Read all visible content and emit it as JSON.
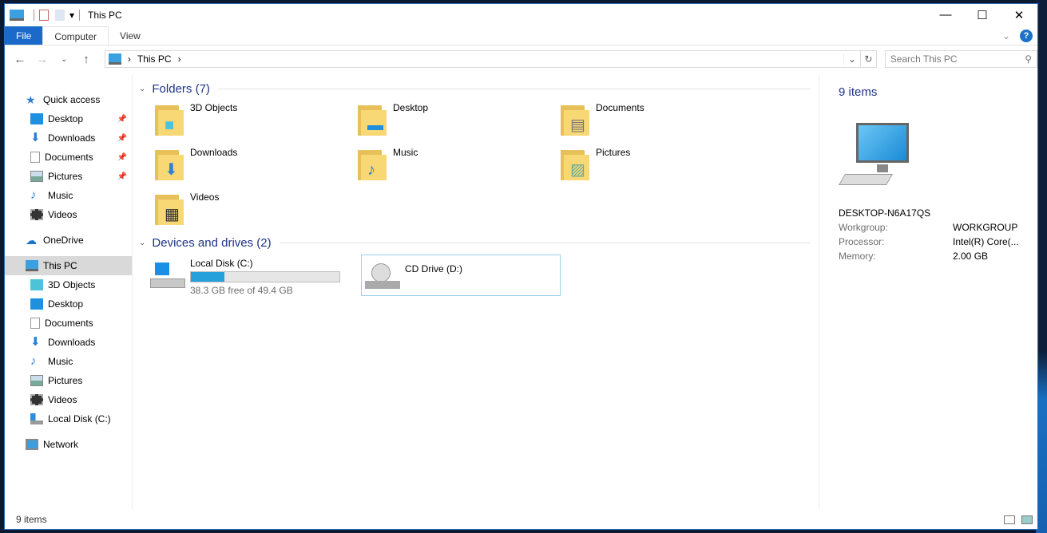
{
  "window": {
    "title": "This PC"
  },
  "ribbon": {
    "tabs": [
      "File",
      "Computer",
      "View"
    ]
  },
  "nav": {
    "path": "This PC",
    "search_placeholder": "Search This PC"
  },
  "sidebar": {
    "quick_access": "Quick access",
    "quick_items": [
      {
        "label": "Desktop",
        "icon": "desktop"
      },
      {
        "label": "Downloads",
        "icon": "downloads"
      },
      {
        "label": "Documents",
        "icon": "documents"
      },
      {
        "label": "Pictures",
        "icon": "pictures"
      },
      {
        "label": "Music",
        "icon": "music"
      },
      {
        "label": "Videos",
        "icon": "videos"
      }
    ],
    "onedrive": "OneDrive",
    "this_pc": "This PC",
    "pc_items": [
      {
        "label": "3D Objects"
      },
      {
        "label": "Desktop"
      },
      {
        "label": "Documents"
      },
      {
        "label": "Downloads"
      },
      {
        "label": "Music"
      },
      {
        "label": "Pictures"
      },
      {
        "label": "Videos"
      },
      {
        "label": "Local Disk (C:)"
      }
    ],
    "network": "Network"
  },
  "main": {
    "folders_header": "Folders (7)",
    "folders": [
      "3D Objects",
      "Desktop",
      "Documents",
      "Downloads",
      "Music",
      "Pictures",
      "Videos"
    ],
    "drives_header": "Devices and drives (2)",
    "drives": [
      {
        "label": "Local Disk (C:)",
        "free": "38.3 GB free of 49.4 GB",
        "used_percent": 22.5
      },
      {
        "label": "CD Drive (D:)"
      }
    ]
  },
  "details": {
    "count": "9 items",
    "name": "DESKTOP-N6A17QS",
    "rows": [
      {
        "k": "Workgroup:",
        "v": "WORKGROUP"
      },
      {
        "k": "Processor:",
        "v": "Intel(R) Core(..."
      },
      {
        "k": "Memory:",
        "v": "2.00 GB"
      }
    ]
  },
  "status": {
    "count": "9 items"
  },
  "colors": {
    "accent": "#1b6ac9",
    "drive_bar": "#26a0da",
    "folder": "#f8d775"
  }
}
